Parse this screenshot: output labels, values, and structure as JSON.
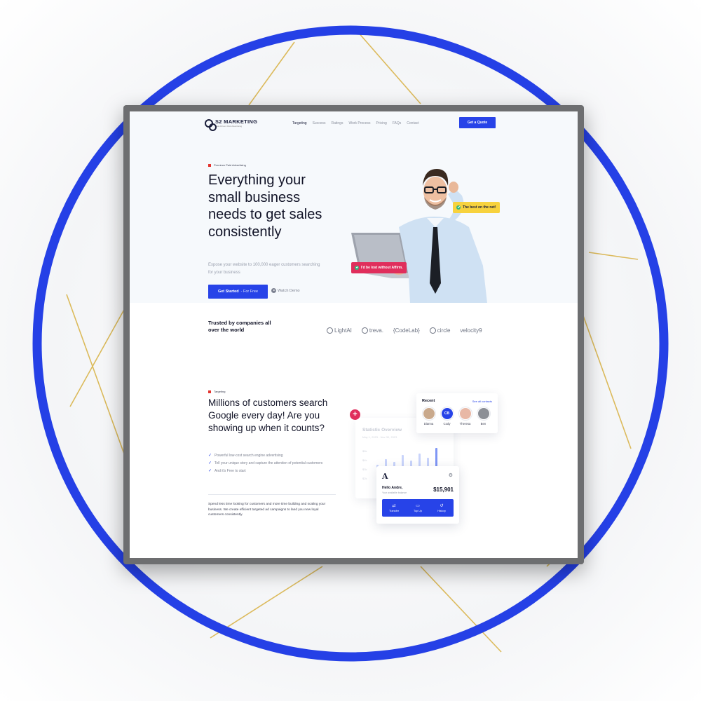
{
  "nav": {
    "logo_text": "S2 MARKETING",
    "logo_sub": "Data Driven Paid Advertising",
    "items": [
      "Targeting",
      "Success",
      "Ratings",
      "Work Process",
      "Pricing",
      "FAQs",
      "Contact"
    ],
    "cta": "Get a Quote"
  },
  "hero": {
    "eyebrow": "Premium Paid Advertising",
    "title_highlight": "Everything",
    "title_rest": " your small business needs to get sales consistently",
    "subtitle": "Expose your website to 100,000 eager customers searching for your business",
    "cta_main": "Get Started",
    "cta_sub": "- For Free",
    "watch_demo": "Watch Demo",
    "badge_yellow": "The best on the net!",
    "badge_red": "I'd be lost without Affirm."
  },
  "trusted": {
    "heading": "Trusted by companies all over the world",
    "brands": [
      "LightAI",
      "treva.",
      "{CodeLab}",
      "circle",
      "velocity9"
    ]
  },
  "targeting": {
    "eyebrow": "Targeting",
    "title_highlight": "Millions",
    "title_rest": " of customers search Google every day! Are you showing up when it counts?",
    "checks": [
      "Powerful low-cost search engine advertising",
      "Tell your unique story and capture the attention of potential customers",
      "And it's Free to start"
    ],
    "paragraph": "Spend less time looking for customers and more time building and scaling your business. We create efficient targeted ad campaigns to land you new loyal customers consistently."
  },
  "stat_card": {
    "title": "Statistic Overview",
    "date_range": "May 1, 2023 - Nov 30, 2023",
    "y_labels": [
      "$5k",
      "$4k",
      "$3k",
      "$2k"
    ],
    "bars": [
      0.15,
      0.35,
      0.25,
      0.5,
      0.3,
      0.55,
      0.4,
      0.75
    ]
  },
  "recent": {
    "title": "Recent",
    "link": "See all contacts",
    "contacts": [
      {
        "name": "Dianna",
        "initials": "",
        "color": "#c9a98c"
      },
      {
        "name": "Cody",
        "initials": "CB",
        "color": "#2743e8"
      },
      {
        "name": "Theresa",
        "initials": "",
        "color": "#e8b8a6"
      },
      {
        "name": "Ben",
        "initials": "",
        "color": "#8c8f96"
      }
    ]
  },
  "bank": {
    "logo": "A",
    "greeting": "Hello Andre,",
    "hint": "Your available balance",
    "amount": "$15,901",
    "actions": [
      {
        "label": "Transfer",
        "icon": "⇄"
      },
      {
        "label": "Top Up",
        "icon": "▭"
      },
      {
        "label": "History",
        "icon": "↺"
      }
    ]
  },
  "colors": {
    "primary": "#2743e8",
    "accent_red": "#e02e5c",
    "highlight": "#f5c518",
    "ring": "#2540e6"
  }
}
